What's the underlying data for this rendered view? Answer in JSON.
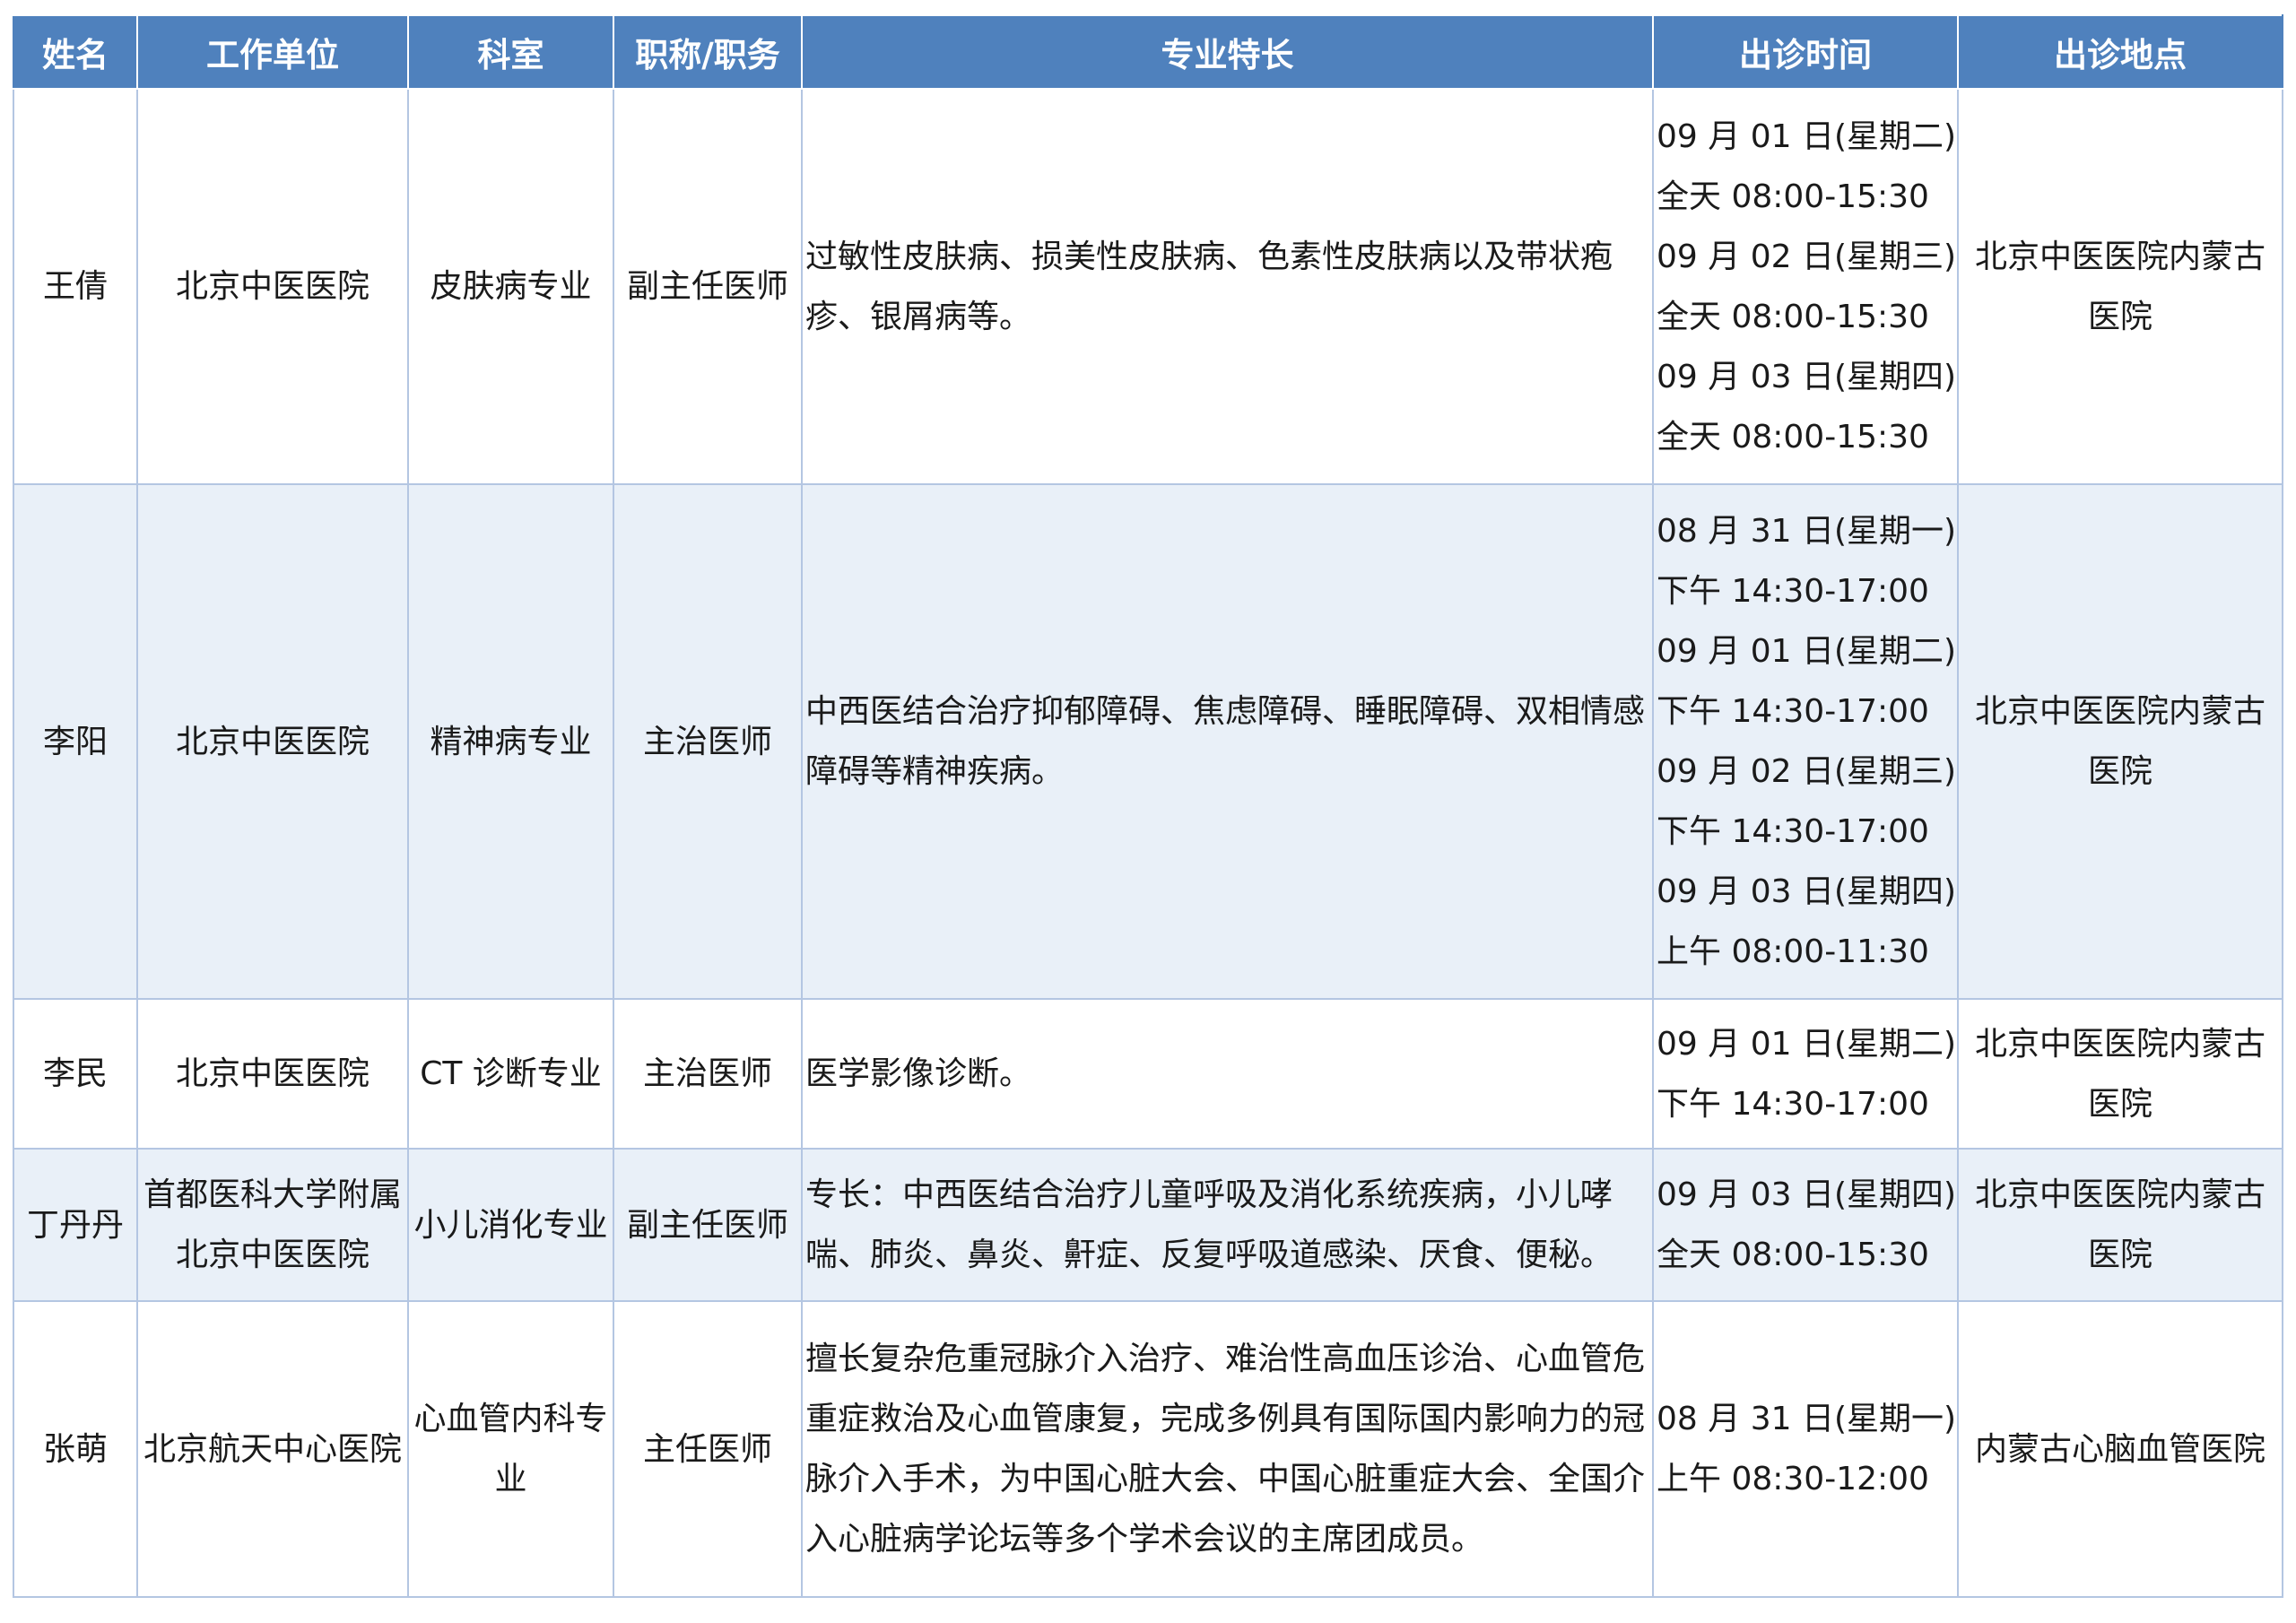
{
  "headers": [
    "姓名",
    "工作单位",
    "科室",
    "职称/职务",
    "专业特长",
    "出诊时间",
    "出诊地点"
  ],
  "rows": [
    {
      "name": "王倩",
      "unit": "北京中医医院",
      "dept": "皮肤病专业",
      "title": "副主任医师",
      "specialty": "过敏性皮肤病、损美性皮肤病、色素性皮肤病以及带状疱疹、银屑病等。",
      "schedule": [
        "09 月 01 日(星期二)",
        "全天 08:00-15:30",
        "09 月 02 日(星期三)",
        "全天 08:00-15:30",
        "09 月 03 日(星期四)",
        "全天 08:00-15:30"
      ],
      "location": "北京中医医院内蒙古医院"
    },
    {
      "name": "李阳",
      "unit": "北京中医医院",
      "dept": "精神病专业",
      "title": "主治医师",
      "specialty": "中西医结合治疗抑郁障碍、焦虑障碍、睡眠障碍、双相情感障碍等精神疾病。",
      "schedule": [
        "08 月 31 日(星期一)",
        "下午 14:30-17:00",
        "09 月 01 日(星期二)",
        "下午 14:30-17:00",
        "09 月 02 日(星期三)",
        "下午 14:30-17:00",
        "09 月 03 日(星期四)",
        "上午 08:00-11:30"
      ],
      "location": "北京中医医院内蒙古医院"
    },
    {
      "name": "李民",
      "unit": "北京中医医院",
      "dept": "CT 诊断专业",
      "title": "主治医师",
      "specialty": "医学影像诊断。",
      "schedule": [
        "09 月 01 日(星期二)",
        "下午 14:30-17:00"
      ],
      "location": "北京中医医院内蒙古医院"
    },
    {
      "name": "丁丹丹",
      "unit": "首都医科大学附属北京中医医院",
      "dept": "小儿消化专业",
      "title": "副主任医师",
      "specialty": "专长：中西医结合治疗儿童呼吸及消化系统疾病，小儿哮喘、肺炎、鼻炎、鼾症、反复呼吸道感染、厌食、便秘。",
      "schedule": [
        "09 月 03 日(星期四)",
        "全天 08:00-15:30"
      ],
      "location": "北京中医医院内蒙古医院"
    },
    {
      "name": "张萌",
      "unit": "北京航天中心医院",
      "dept": "心血管内科专业",
      "title": "主任医师",
      "specialty": "擅长复杂危重冠脉介入治疗、难治性高血压诊治、心血管危重症救治及心血管康复，完成多例具有国际国内影响力的冠脉介入手术，为中国心脏大会、中国心脏重症大会、全国介入心脏病学论坛等多个学术会议的主席团成员。",
      "schedule": [
        "08 月 31 日(星期一)",
        "上午 08:30-12:00"
      ],
      "location": "内蒙古心脑血管医院"
    }
  ]
}
